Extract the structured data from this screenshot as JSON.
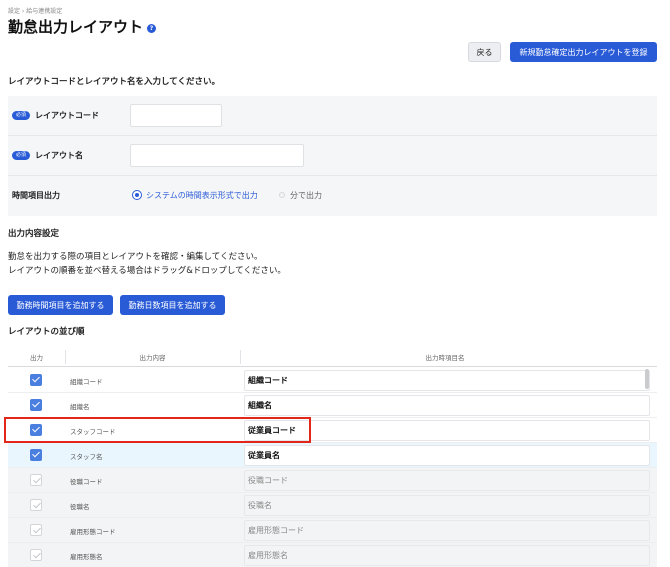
{
  "breadcrumb": "設定 › 給与連携設定",
  "title": "勤怠出力レイアウト",
  "header": {
    "back_label": "戻る",
    "register_label": "新規勤怠確定出力レイアウトを登録"
  },
  "instruction": "レイアウトコードとレイアウト名を入力してください。",
  "form": {
    "required_badge": "必須",
    "layout_code_label": "レイアウトコード",
    "layout_code_value": "",
    "layout_name_label": "レイアウト名",
    "layout_name_value": "",
    "time_output_label": "時間項目出力",
    "time_option_system": "システムの時間表示形式で出力",
    "time_option_minutes": "分で出力",
    "time_selected": "システムの時間表示形式で出力"
  },
  "section": {
    "heading": "出力内容設定",
    "desc_line1": "勤怠を出力する際の項目とレイアウトを確認・編集してください。",
    "desc_line2": "レイアウトの順番を並べ替える場合はドラッグ&ドロップしてください。",
    "add_time_item": "勤務時間項目を追加する",
    "add_days_item": "勤務日数項目を追加する"
  },
  "order_heading": "レイアウトの並び順",
  "table": {
    "headers": [
      "出力",
      "出力内容",
      "出力時項目名"
    ],
    "rows": [
      {
        "content": "組織コード",
        "name": "組織コード",
        "checked": true,
        "disabled": false
      },
      {
        "content": "組織名",
        "name": "組織名",
        "checked": true,
        "disabled": false
      },
      {
        "content": "スタッフコード",
        "name": "従業員コード",
        "checked": true,
        "disabled": false
      },
      {
        "content": "スタッフ名",
        "name": "従業員名",
        "checked": true,
        "disabled": false
      },
      {
        "content": "役職コード",
        "name": "役職コード",
        "checked": true,
        "disabled": true
      },
      {
        "content": "役職名",
        "name": "役職名",
        "checked": true,
        "disabled": true
      },
      {
        "content": "雇用形態コード",
        "name": "雇用形態コード",
        "checked": true,
        "disabled": true
      },
      {
        "content": "雇用形態名",
        "name": "雇用形態名",
        "checked": true,
        "disabled": true
      }
    ]
  },
  "colors": {
    "accent": "#2a5bd7",
    "highlight_border": "#e3261a"
  }
}
